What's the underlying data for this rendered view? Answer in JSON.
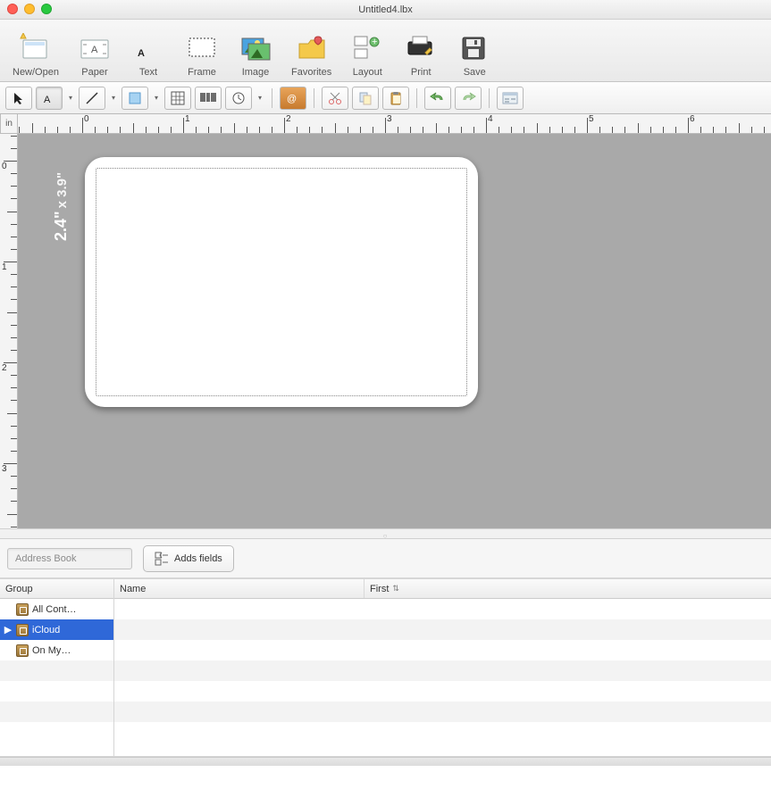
{
  "window": {
    "title": "Untitled4.lbx"
  },
  "ruler_unit": "in",
  "main_toolbar": [
    {
      "label": "New/Open"
    },
    {
      "label": "Paper"
    },
    {
      "label": "Text"
    },
    {
      "label": "Frame"
    },
    {
      "label": "Image"
    },
    {
      "label": "Favorites"
    },
    {
      "label": "Layout"
    },
    {
      "label": "Print"
    },
    {
      "label": "Save"
    }
  ],
  "label_dims": {
    "line1": "2.4\"",
    "line2": "x 3.9\""
  },
  "hruler_labels": [
    "0",
    "1",
    "2",
    "3",
    "4",
    "5",
    "6"
  ],
  "vruler_labels": [
    "0",
    "1",
    "2",
    "3"
  ],
  "address_book": {
    "source_label": "Address Book",
    "add_fields_label": "Adds fields",
    "headers": {
      "group": "Group",
      "name": "Name",
      "first": "First"
    },
    "groups": [
      {
        "label": "All Cont…"
      },
      {
        "label": "iCloud",
        "selected": true,
        "expandable": true
      },
      {
        "label": "On My…"
      }
    ]
  }
}
